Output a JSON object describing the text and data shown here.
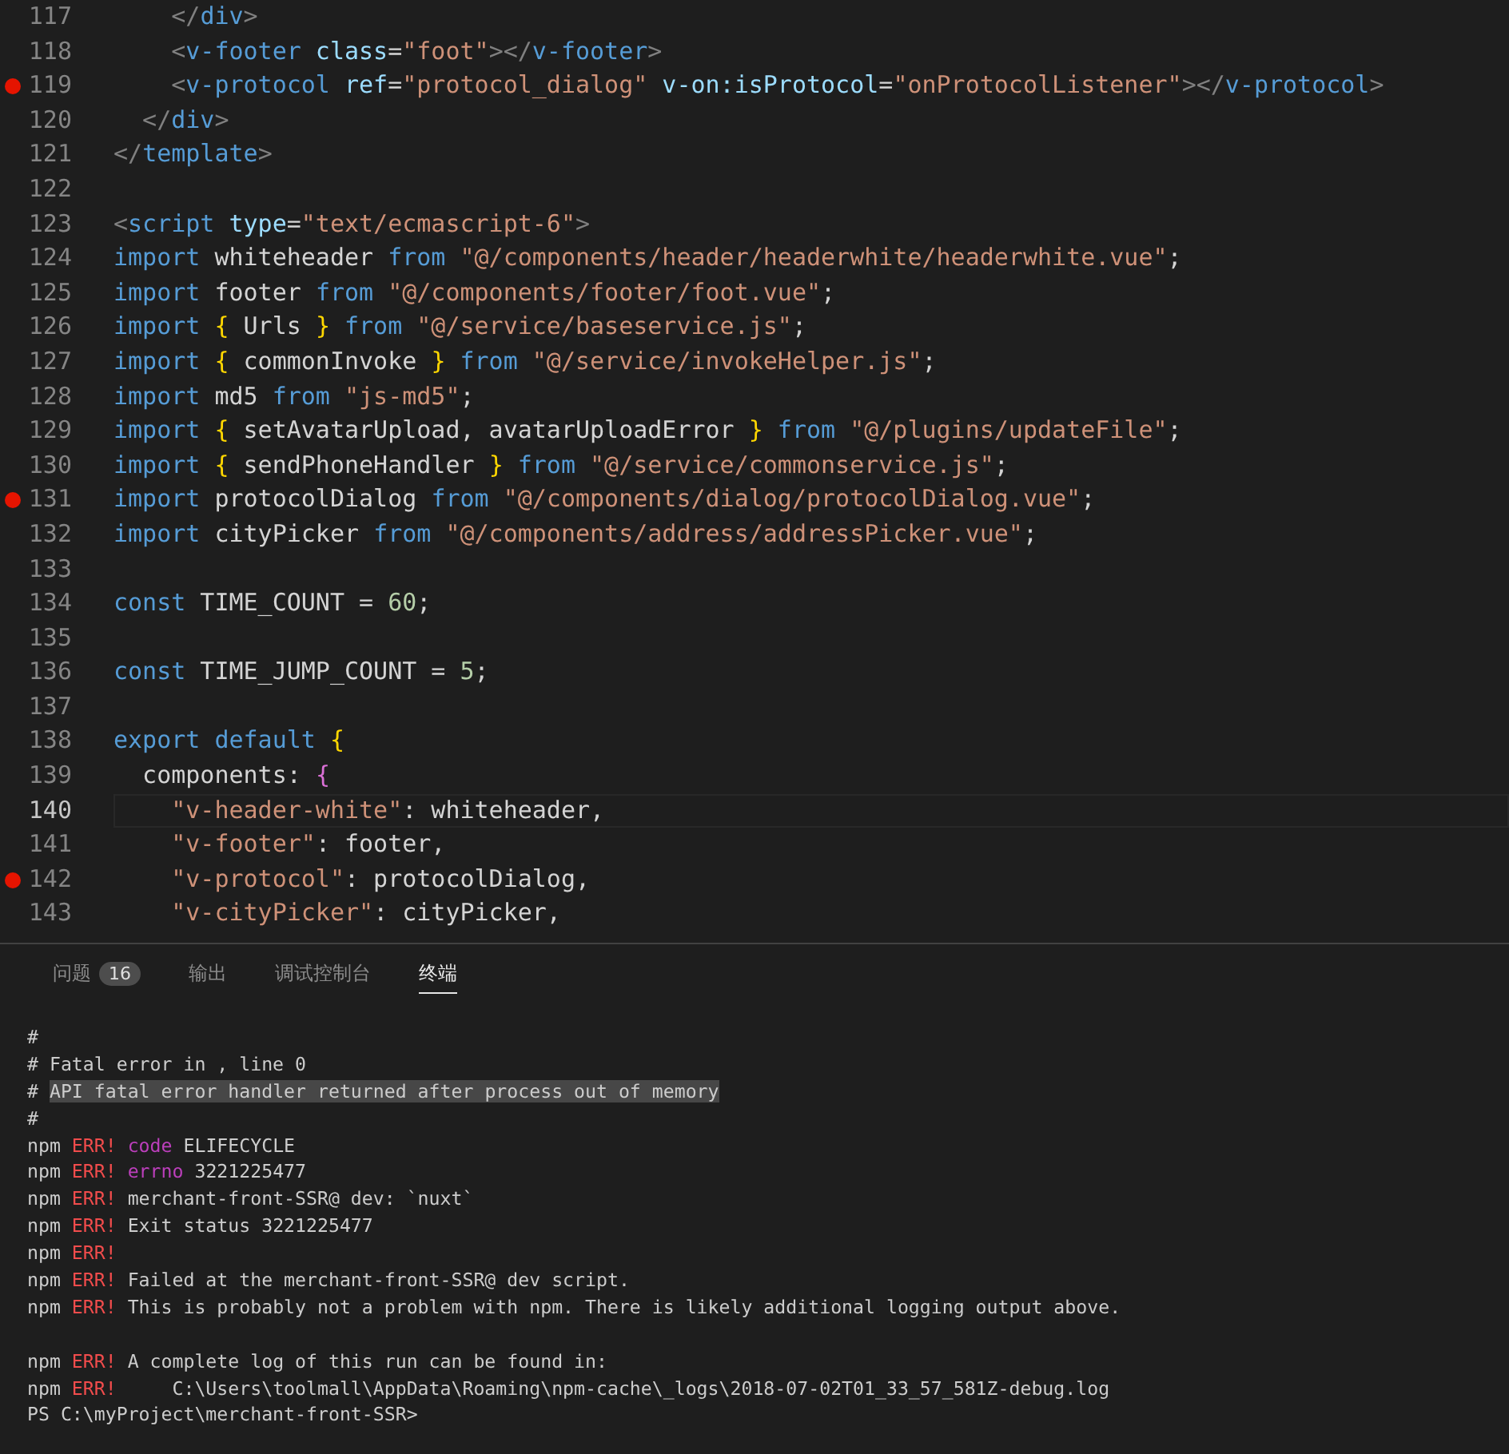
{
  "editor": {
    "lines": [
      {
        "number": "117",
        "breakpoint": false,
        "current": false,
        "tokens": [
          {
            "kind": "punct",
            "text": "    </"
          },
          {
            "kind": "tag",
            "text": "div"
          },
          {
            "kind": "punct",
            "text": ">"
          }
        ]
      },
      {
        "number": "118",
        "breakpoint": false,
        "current": false,
        "tokens": [
          {
            "kind": "punct",
            "text": "    <"
          },
          {
            "kind": "tag",
            "text": "v-footer"
          },
          {
            "kind": "attr",
            "text": " class"
          },
          {
            "kind": "plain",
            "text": "="
          },
          {
            "kind": "string",
            "text": "\"foot\""
          },
          {
            "kind": "punct",
            "text": "></"
          },
          {
            "kind": "tag",
            "text": "v-footer"
          },
          {
            "kind": "punct",
            "text": ">"
          }
        ]
      },
      {
        "number": "119",
        "breakpoint": true,
        "current": false,
        "tokens": [
          {
            "kind": "punct",
            "text": "    <"
          },
          {
            "kind": "tag",
            "text": "v-protocol"
          },
          {
            "kind": "attr",
            "text": " ref"
          },
          {
            "kind": "plain",
            "text": "="
          },
          {
            "kind": "string",
            "text": "\"protocol_dialog\""
          },
          {
            "kind": "attr",
            "text": " v-on:isProtocol"
          },
          {
            "kind": "plain",
            "text": "="
          },
          {
            "kind": "string",
            "text": "\"onProtocolListener\""
          },
          {
            "kind": "punct",
            "text": "></"
          },
          {
            "kind": "tag",
            "text": "v-protocol"
          },
          {
            "kind": "punct",
            "text": ">"
          }
        ]
      },
      {
        "number": "120",
        "breakpoint": false,
        "current": false,
        "tokens": [
          {
            "kind": "punct",
            "text": "  </"
          },
          {
            "kind": "tag",
            "text": "div"
          },
          {
            "kind": "punct",
            "text": ">"
          }
        ]
      },
      {
        "number": "121",
        "breakpoint": false,
        "current": false,
        "tokens": [
          {
            "kind": "punct",
            "text": "</"
          },
          {
            "kind": "tag",
            "text": "template"
          },
          {
            "kind": "punct",
            "text": ">"
          }
        ]
      },
      {
        "number": "122",
        "breakpoint": false,
        "current": false
      },
      {
        "number": "123",
        "breakpoint": false,
        "current": false,
        "tokens": [
          {
            "kind": "punct",
            "text": "<"
          },
          {
            "kind": "tag",
            "text": "script"
          },
          {
            "kind": "attr",
            "text": " type"
          },
          {
            "kind": "plain",
            "text": "="
          },
          {
            "kind": "string",
            "text": "\"text/ecmascript-6\""
          },
          {
            "kind": "punct",
            "text": ">"
          }
        ]
      },
      {
        "number": "124",
        "breakpoint": false,
        "current": false,
        "tokens": [
          {
            "kind": "keyword",
            "text": "import"
          },
          {
            "kind": "plain",
            "text": " whiteheader "
          },
          {
            "kind": "keyword",
            "text": "from"
          },
          {
            "kind": "string",
            "text": " \"@/components/header/headerwhite/headerwhite.vue\""
          },
          {
            "kind": "plain",
            "text": ";"
          }
        ]
      },
      {
        "number": "125",
        "breakpoint": false,
        "current": false,
        "tokens": [
          {
            "kind": "keyword",
            "text": "import"
          },
          {
            "kind": "plain",
            "text": " footer "
          },
          {
            "kind": "keyword",
            "text": "from"
          },
          {
            "kind": "string",
            "text": " \"@/components/footer/foot.vue\""
          },
          {
            "kind": "plain",
            "text": ";"
          }
        ]
      },
      {
        "number": "126",
        "breakpoint": false,
        "current": false,
        "tokens": [
          {
            "kind": "keyword",
            "text": "import"
          },
          {
            "kind": "brace",
            "text": " {"
          },
          {
            "kind": "plain",
            "text": " Urls "
          },
          {
            "kind": "brace",
            "text": "}"
          },
          {
            "kind": "keyword",
            "text": " from"
          },
          {
            "kind": "string",
            "text": " \"@/service/baseservice.js\""
          },
          {
            "kind": "plain",
            "text": ";"
          }
        ]
      },
      {
        "number": "127",
        "breakpoint": false,
        "current": false,
        "tokens": [
          {
            "kind": "keyword",
            "text": "import"
          },
          {
            "kind": "brace",
            "text": " {"
          },
          {
            "kind": "plain",
            "text": " commonInvoke "
          },
          {
            "kind": "brace",
            "text": "}"
          },
          {
            "kind": "keyword",
            "text": " from"
          },
          {
            "kind": "string",
            "text": " \"@/service/invokeHelper.js\""
          },
          {
            "kind": "plain",
            "text": ";"
          }
        ]
      },
      {
        "number": "128",
        "breakpoint": false,
        "current": false,
        "tokens": [
          {
            "kind": "keyword",
            "text": "import"
          },
          {
            "kind": "plain",
            "text": " md5 "
          },
          {
            "kind": "keyword",
            "text": "from"
          },
          {
            "kind": "string",
            "text": " \"js-md5\""
          },
          {
            "kind": "plain",
            "text": ";"
          }
        ]
      },
      {
        "number": "129",
        "breakpoint": false,
        "current": false,
        "tokens": [
          {
            "kind": "keyword",
            "text": "import"
          },
          {
            "kind": "brace",
            "text": " {"
          },
          {
            "kind": "plain",
            "text": " setAvatarUpload, avatarUploadError "
          },
          {
            "kind": "brace",
            "text": "}"
          },
          {
            "kind": "keyword",
            "text": " from"
          },
          {
            "kind": "string",
            "text": " \"@/plugins/updateFile\""
          },
          {
            "kind": "plain",
            "text": ";"
          }
        ]
      },
      {
        "number": "130",
        "breakpoint": false,
        "current": false,
        "tokens": [
          {
            "kind": "keyword",
            "text": "import"
          },
          {
            "kind": "brace",
            "text": " {"
          },
          {
            "kind": "plain",
            "text": " sendPhoneHandler "
          },
          {
            "kind": "brace",
            "text": "}"
          },
          {
            "kind": "keyword",
            "text": " from"
          },
          {
            "kind": "string",
            "text": " \"@/service/commonservice.js\""
          },
          {
            "kind": "plain",
            "text": ";"
          }
        ]
      },
      {
        "number": "131",
        "breakpoint": true,
        "current": false,
        "tokens": [
          {
            "kind": "keyword",
            "text": "import"
          },
          {
            "kind": "plain",
            "text": " protocolDialog "
          },
          {
            "kind": "keyword",
            "text": "from"
          },
          {
            "kind": "string",
            "text": " \"@/components/dialog/protocolDialog.vue\""
          },
          {
            "kind": "plain",
            "text": ";"
          }
        ]
      },
      {
        "number": "132",
        "breakpoint": false,
        "current": false,
        "tokens": [
          {
            "kind": "keyword",
            "text": "import"
          },
          {
            "kind": "plain",
            "text": " cityPicker "
          },
          {
            "kind": "keyword",
            "text": "from"
          },
          {
            "kind": "string",
            "text": " \"@/components/address/addressPicker.vue\""
          },
          {
            "kind": "plain",
            "text": ";"
          }
        ]
      },
      {
        "number": "133",
        "breakpoint": false,
        "current": false
      },
      {
        "number": "134",
        "breakpoint": false,
        "current": false,
        "tokens": [
          {
            "kind": "keyword",
            "text": "const"
          },
          {
            "kind": "plain",
            "text": " TIME_COUNT = "
          },
          {
            "kind": "number",
            "text": "60"
          },
          {
            "kind": "plain",
            "text": ";"
          }
        ]
      },
      {
        "number": "135",
        "breakpoint": false,
        "current": false
      },
      {
        "number": "136",
        "breakpoint": false,
        "current": false,
        "tokens": [
          {
            "kind": "keyword",
            "text": "const"
          },
          {
            "kind": "plain",
            "text": " TIME_JUMP_COUNT = "
          },
          {
            "kind": "number",
            "text": "5"
          },
          {
            "kind": "plain",
            "text": ";"
          }
        ]
      },
      {
        "number": "137",
        "breakpoint": false,
        "current": false
      },
      {
        "number": "138",
        "breakpoint": false,
        "current": false,
        "tokens": [
          {
            "kind": "keyword",
            "text": "export default"
          },
          {
            "kind": "brace",
            "text": " {"
          }
        ]
      },
      {
        "number": "139",
        "breakpoint": false,
        "current": false,
        "tokens": [
          {
            "kind": "plain",
            "text": "  components: "
          },
          {
            "kind": "brace2",
            "text": "{"
          }
        ]
      },
      {
        "number": "140",
        "breakpoint": false,
        "current": true,
        "tokens": [
          {
            "kind": "string",
            "text": "    \"v-header-white\""
          },
          {
            "kind": "plain",
            "text": ": whiteheader,"
          }
        ]
      },
      {
        "number": "141",
        "breakpoint": false,
        "current": false,
        "tokens": [
          {
            "kind": "string",
            "text": "    \"v-footer\""
          },
          {
            "kind": "plain",
            "text": ": footer,"
          }
        ]
      },
      {
        "number": "142",
        "breakpoint": true,
        "current": false,
        "tokens": [
          {
            "kind": "string",
            "text": "    \"v-protocol\""
          },
          {
            "kind": "plain",
            "text": ": protocolDialog,"
          }
        ]
      },
      {
        "number": "143",
        "breakpoint": false,
        "current": false,
        "tokens": [
          {
            "kind": "string",
            "text": "    \"v-cityPicker\""
          },
          {
            "kind": "plain",
            "text": ": cityPicker,"
          }
        ]
      }
    ]
  },
  "panel": {
    "tabs": [
      {
        "label": "问题",
        "badge": "16",
        "selected": false
      },
      {
        "label": "输出",
        "selected": false
      },
      {
        "label": "调试控制台",
        "selected": false
      },
      {
        "label": "终端",
        "selected": true
      }
    ],
    "terminal": [
      {
        "tokens": [
          {
            "kind": "plain",
            "text": "#"
          }
        ]
      },
      {
        "tokens": [
          {
            "kind": "plain",
            "text": "# Fatal error in , line 0"
          }
        ]
      },
      {
        "tokens": [
          {
            "kind": "plain",
            "text": "# "
          },
          {
            "kind": "selected",
            "text": "API fatal error handler returned after process out of memory"
          }
        ]
      },
      {
        "tokens": [
          {
            "kind": "plain",
            "text": "#"
          }
        ]
      },
      {
        "tokens": [
          {
            "kind": "plain",
            "text": "npm "
          },
          {
            "kind": "err",
            "text": "ERR!"
          },
          {
            "kind": "magenta",
            "text": " code"
          },
          {
            "kind": "plain",
            "text": " ELIFECYCLE"
          }
        ]
      },
      {
        "tokens": [
          {
            "kind": "plain",
            "text": "npm "
          },
          {
            "kind": "err",
            "text": "ERR!"
          },
          {
            "kind": "magenta",
            "text": " errno"
          },
          {
            "kind": "plain",
            "text": " 3221225477"
          }
        ]
      },
      {
        "tokens": [
          {
            "kind": "plain",
            "text": "npm "
          },
          {
            "kind": "err",
            "text": "ERR!"
          },
          {
            "kind": "plain",
            "text": " merchant-front-SSR@ dev: `nuxt`"
          }
        ]
      },
      {
        "tokens": [
          {
            "kind": "plain",
            "text": "npm "
          },
          {
            "kind": "err",
            "text": "ERR!"
          },
          {
            "kind": "plain",
            "text": " Exit status 3221225477"
          }
        ]
      },
      {
        "tokens": [
          {
            "kind": "plain",
            "text": "npm "
          },
          {
            "kind": "err",
            "text": "ERR!"
          }
        ]
      },
      {
        "tokens": [
          {
            "kind": "plain",
            "text": "npm "
          },
          {
            "kind": "err",
            "text": "ERR!"
          },
          {
            "kind": "plain",
            "text": " Failed at the merchant-front-SSR@ dev script."
          }
        ]
      },
      {
        "tokens": [
          {
            "kind": "plain",
            "text": "npm "
          },
          {
            "kind": "err",
            "text": "ERR!"
          },
          {
            "kind": "plain",
            "text": " This is probably not a problem with npm. There is likely additional logging output above."
          }
        ]
      },
      {
        "blank_before": true,
        "tokens": [
          {
            "kind": "plain",
            "text": "npm "
          },
          {
            "kind": "err",
            "text": "ERR!"
          },
          {
            "kind": "plain",
            "text": " A complete log of this run can be found in:"
          }
        ]
      },
      {
        "tokens": [
          {
            "kind": "plain",
            "text": "npm "
          },
          {
            "kind": "err",
            "text": "ERR!"
          },
          {
            "kind": "plain",
            "text": "     C:\\Users\\toolmall\\AppData\\Roaming\\npm-cache\\_logs\\2018-07-02T01_33_57_581Z-debug.log"
          }
        ]
      },
      {
        "tokens": [
          {
            "kind": "plain",
            "text": "PS C:\\myProject\\merchant-front-SSR>"
          }
        ]
      }
    ]
  }
}
